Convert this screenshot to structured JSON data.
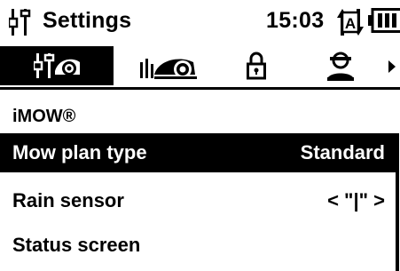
{
  "header": {
    "title": "Settings",
    "time": "15:03",
    "icons": [
      "settings-wrench-icon",
      "auto-mode-icon",
      "battery-icon"
    ]
  },
  "tabs": [
    {
      "icon": "tools-settings-icon",
      "active": true
    },
    {
      "icon": "robot-mower-icon",
      "active": false
    },
    {
      "icon": "lock-icon",
      "active": false
    },
    {
      "icon": "user-icon",
      "active": false
    },
    {
      "icon": "arrow-right-icon",
      "active": false
    }
  ],
  "section": {
    "title": "iMOW®"
  },
  "rows": [
    {
      "label": "Mow plan type",
      "value": "Standard",
      "selected": true
    },
    {
      "label": "Rain sensor",
      "value": "< \"|\" >",
      "selected": false
    },
    {
      "label": "Status screen",
      "value": "",
      "selected": false
    }
  ]
}
